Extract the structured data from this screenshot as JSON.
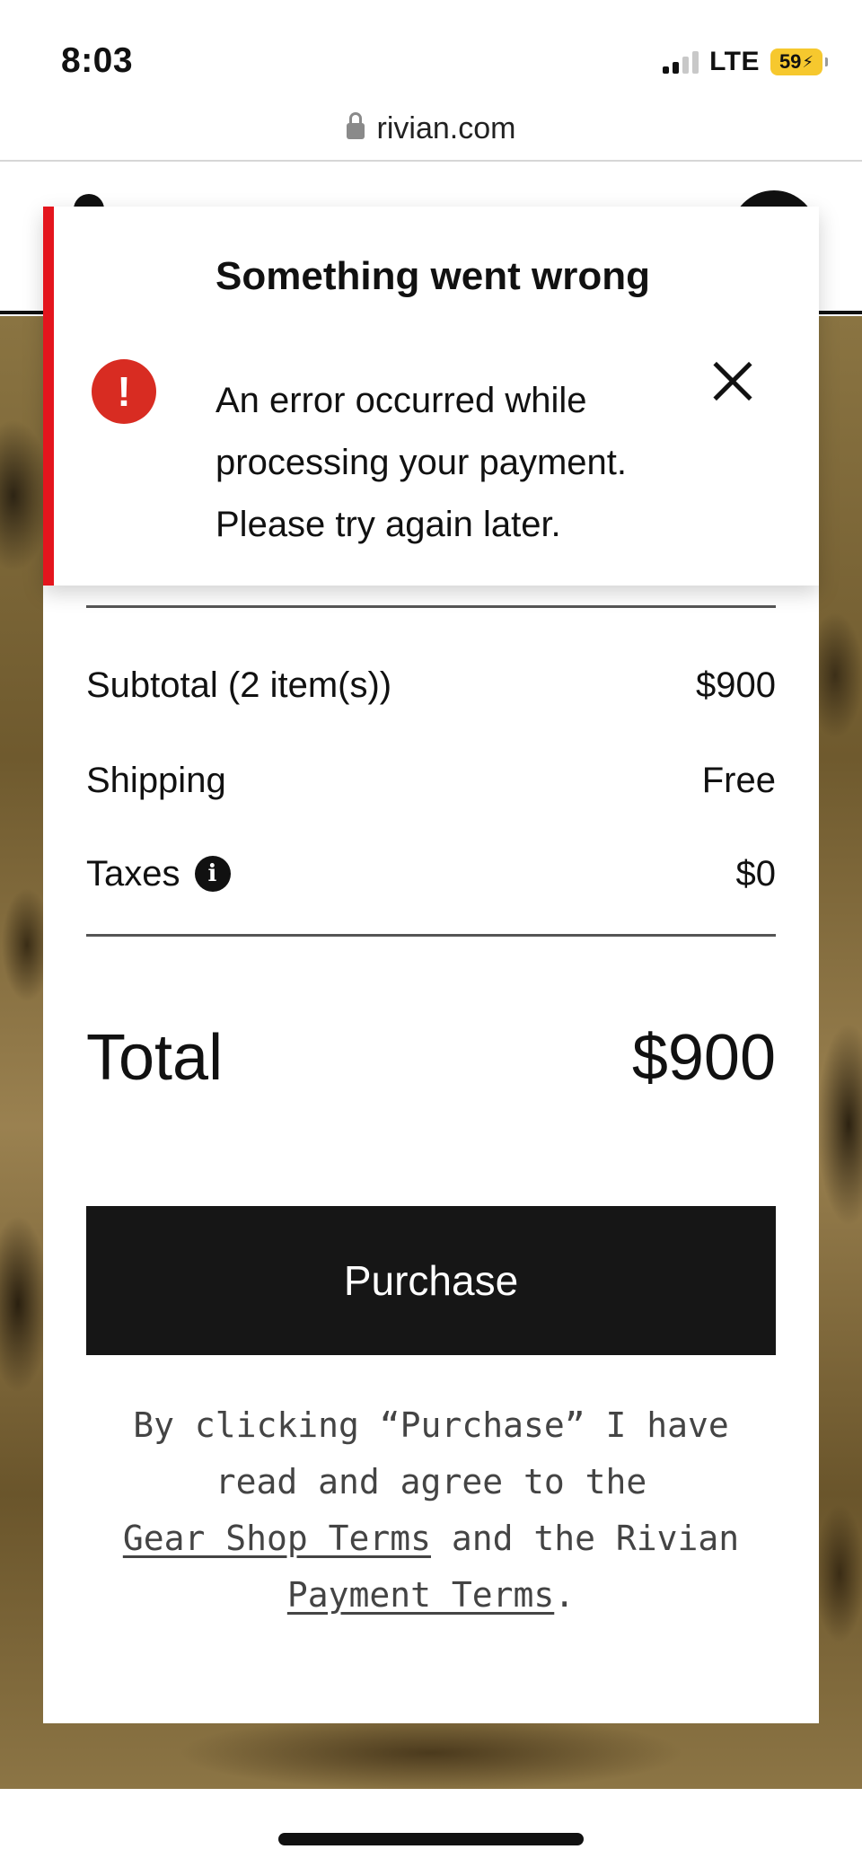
{
  "status_bar": {
    "time": "8:03",
    "network": "LTE",
    "battery": "59"
  },
  "browser": {
    "url": "rivian.com"
  },
  "error_toast": {
    "title": "Something went wrong",
    "message": "An error occurred while processing your payment. Please try again later.",
    "accent_color": "#e4151d"
  },
  "summary": {
    "subtotal_label": "Subtotal (2 item(s))",
    "subtotal_value": "$900",
    "shipping_label": "Shipping",
    "shipping_value": "Free",
    "taxes_label": "Taxes",
    "taxes_value": "$0",
    "total_label": "Total",
    "total_value": "$900"
  },
  "purchase_button": {
    "label": "Purchase"
  },
  "terms": {
    "text_1": "By clicking “Purchase” I have read and agree to the",
    "link_gear": "Gear Shop Terms",
    "text_2": "and the Rivian",
    "link_payment": "Payment Terms",
    "text_3": "."
  }
}
